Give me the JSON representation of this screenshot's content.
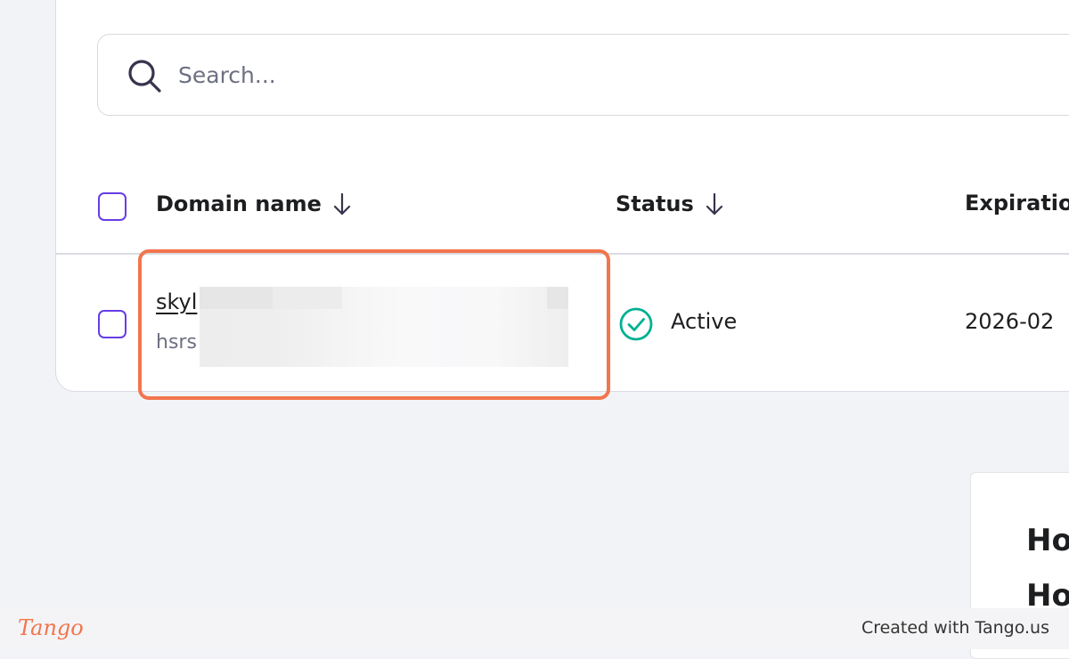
{
  "search": {
    "placeholder": "Search..."
  },
  "table": {
    "columns": [
      {
        "label": "Domain name"
      },
      {
        "label": "Status"
      },
      {
        "label": "Expiration"
      }
    ],
    "rows": [
      {
        "domain": "skyl",
        "subtext": "hsrs",
        "status": "Active",
        "expiration": "2026-02"
      }
    ]
  },
  "promo": {
    "lines": [
      "Ho",
      "Ho"
    ]
  },
  "footer": {
    "logo_text": "Tango",
    "credit": "Created with Tango.us"
  },
  "colors": {
    "accent": "#673de6",
    "highlight": "#f2754d",
    "status_active": "#00b090"
  }
}
